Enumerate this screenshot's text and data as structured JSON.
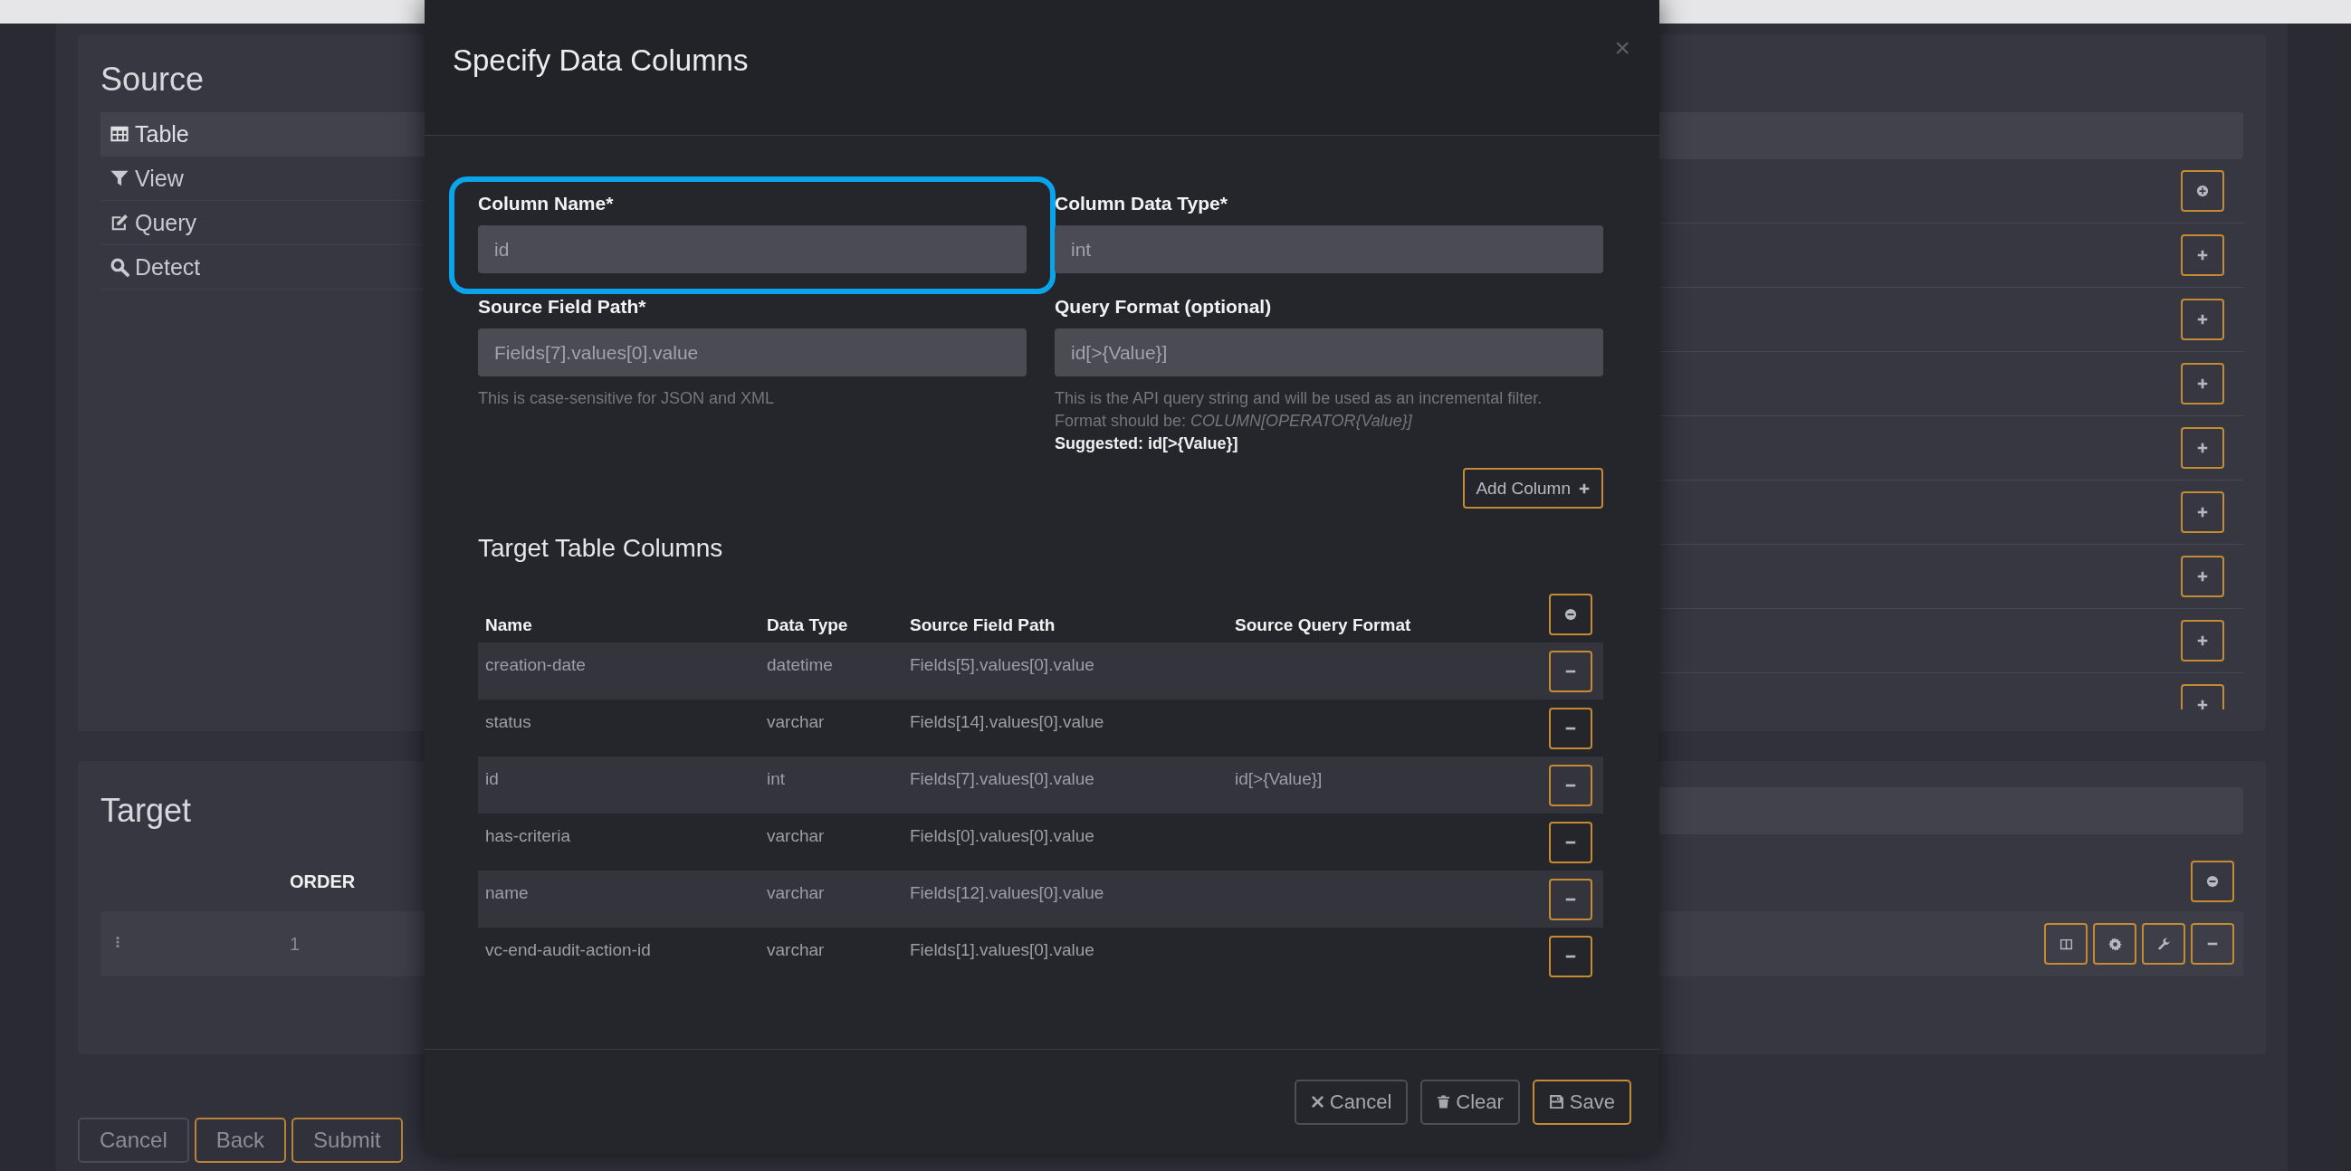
{
  "page": {
    "source": {
      "title": "Source",
      "tabs": [
        {
          "label": "Table",
          "kind": "table",
          "selected": true
        },
        {
          "label": "View",
          "kind": "filter",
          "selected": false
        },
        {
          "label": "Query",
          "kind": "edit",
          "selected": false
        },
        {
          "label": "Detect",
          "kind": "search",
          "selected": false
        }
      ],
      "row_actions": [
        {
          "kind": "add-circle"
        },
        {
          "kind": "add"
        },
        {
          "kind": "add"
        },
        {
          "kind": "add"
        },
        {
          "kind": "add"
        },
        {
          "kind": "add"
        },
        {
          "kind": "add"
        },
        {
          "kind": "add"
        },
        {
          "kind": "add"
        }
      ]
    },
    "target": {
      "title": "Target",
      "columns": [
        "ORDER"
      ],
      "header_action": {
        "kind": "remove-circle"
      },
      "rows": [
        {
          "order": "1",
          "actions": [
            {
              "kind": "columns"
            },
            {
              "kind": "settings"
            },
            {
              "kind": "wrench"
            },
            {
              "kind": "remove"
            }
          ]
        }
      ]
    },
    "buttons": [
      {
        "label": "Cancel",
        "kind": "default"
      },
      {
        "label": "Back",
        "kind": "warning"
      },
      {
        "label": "Submit",
        "kind": "warning"
      }
    ]
  },
  "modal": {
    "title": "Specify Data Columns",
    "close": "×",
    "fields": [
      {
        "label": "Column Name*",
        "value": "id",
        "highlighted": true
      },
      {
        "label": "Column Data Type*",
        "value": "int",
        "highlighted": false
      },
      {
        "label": "Source Field Path*",
        "value": "Fields[7].values[0].value",
        "highlighted": false,
        "help": [
          "This is case-sensitive for JSON and XML"
        ]
      },
      {
        "label": "Query Format (optional)",
        "value": "id[>{Value}]",
        "highlighted": false,
        "help": [
          "This is the API query string and will be used as an incremental filter.",
          "Format should be: *COLUMN[OPERATOR{Value}]*"
        ],
        "suggestion": "Suggested: id[>{Value}]"
      }
    ],
    "add_button": "Add Column",
    "table_title": "Target Table Columns",
    "table": {
      "columns": [
        "Name",
        "Data Type",
        "Source Field Path",
        "Source Query Format"
      ],
      "header_action": {
        "kind": "remove-circle"
      },
      "rows": [
        {
          "name": "creation-date",
          "data_type": "datetime",
          "source_field_path": "Fields[5].values[0].value"
        },
        {
          "name": "status",
          "data_type": "varchar",
          "source_field_path": "Fields[14].values[0].value"
        },
        {
          "name": "id",
          "data_type": "int",
          "source_field_path": "Fields[7].values[0].value",
          "source_query_format": "id[>{Value}]"
        },
        {
          "name": "has-criteria",
          "data_type": "varchar",
          "source_field_path": "Fields[0].values[0].value"
        },
        {
          "name": "name",
          "data_type": "varchar",
          "source_field_path": "Fields[12].values[0].value"
        },
        {
          "name": "vc-end-audit-action-id",
          "data_type": "varchar",
          "source_field_path": "Fields[1].values[0].value"
        }
      ]
    },
    "footer_buttons": [
      {
        "label": "Cancel",
        "kind": "cancel"
      },
      {
        "label": "Clear",
        "kind": "clear"
      },
      {
        "label": "Save",
        "kind": "save"
      }
    ]
  }
}
